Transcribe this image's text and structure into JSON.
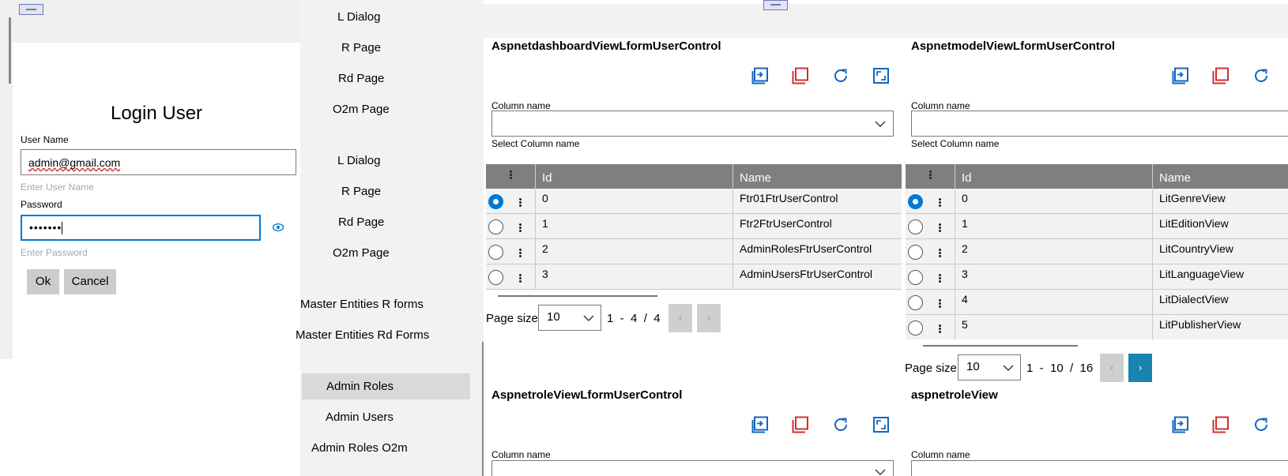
{
  "login": {
    "title": "Login User",
    "username_label": "User Name",
    "username_value": "admin@gmail.com",
    "username_hint": "Enter User Name",
    "password_label": "Password",
    "password_value": "•••••••",
    "password_hint": "Enter Password",
    "ok_label": "Ok",
    "cancel_label": "Cancel"
  },
  "nav": {
    "items": [
      "L Dialog",
      "R Page",
      "Rd Page",
      "O2m Page",
      "L Dialog",
      "R Page",
      "Rd Page",
      "O2m Page",
      "Master Entities R forms",
      "Master Entities Rd Forms",
      "Admin Roles",
      "Admin Users",
      "Admin Roles O2m"
    ],
    "selected": "Admin Roles"
  },
  "colors": {
    "accent": "#0078d4",
    "icon_blue": "#1565c0",
    "icon_red": "#d32f2f",
    "header_gray": "#7f7f7f",
    "pager_active": "#1a84b0"
  },
  "panels": [
    {
      "title": "AspnetdashboardViewLformUserControl",
      "column_label": "Column name",
      "column_hint": "Select Column name",
      "headers": [
        "Id",
        "Name"
      ],
      "rows": [
        {
          "id": "0",
          "name": "Ftr01FtrUserControl",
          "selected": true
        },
        {
          "id": "1",
          "name": "Ftr2FtrUserControl",
          "selected": false
        },
        {
          "id": "2",
          "name": "AdminRolesFtrUserControl",
          "selected": false
        },
        {
          "id": "3",
          "name": "AdminUsersFtrUserControl",
          "selected": false
        }
      ],
      "pager": {
        "label": "Page size",
        "size": "10",
        "from": "1",
        "to": "4",
        "total": "4"
      }
    },
    {
      "title": "AspnetmodelViewLformUserControl",
      "column_label": "Column name",
      "column_hint": "Select Column name",
      "headers": [
        "Id",
        "Name"
      ],
      "rows": [
        {
          "id": "0",
          "name": "LitGenreView",
          "selected": true
        },
        {
          "id": "1",
          "name": "LitEditionView",
          "selected": false
        },
        {
          "id": "2",
          "name": "LitCountryView",
          "selected": false
        },
        {
          "id": "3",
          "name": "LitLanguageView",
          "selected": false
        },
        {
          "id": "4",
          "name": "LitDialectView",
          "selected": false
        },
        {
          "id": "5",
          "name": "LitPublisherView",
          "selected": false
        }
      ],
      "pager": {
        "label": "Page size",
        "size": "10",
        "from": "1",
        "to": "10",
        "total": "16"
      }
    },
    {
      "title": "AspnetroleViewLformUserControl",
      "column_label": "Column name"
    },
    {
      "title": "aspnetroleView",
      "column_label": "Column name"
    }
  ],
  "icons": [
    "insert-icon",
    "copy-icon",
    "refresh-icon",
    "expand-icon",
    "eye-icon",
    "chevron-down-icon",
    "kebab-icon"
  ]
}
